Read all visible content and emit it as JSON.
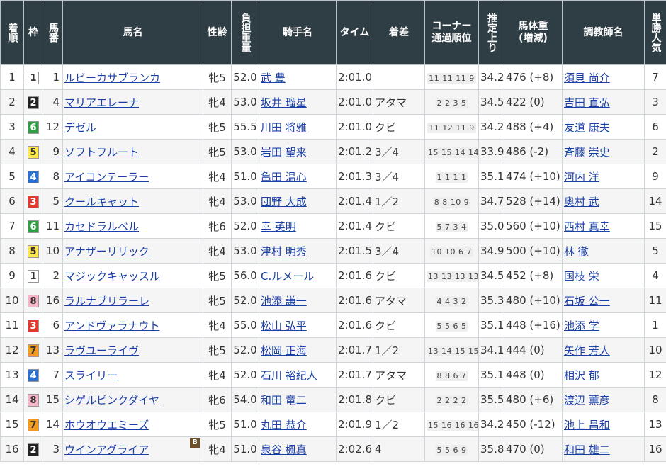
{
  "headers": {
    "finish": "着順",
    "waku": "枠",
    "number": "馬番",
    "horse": "馬名",
    "sexage": "性齢",
    "weight": "負担重量",
    "jockey": "騎手名",
    "time": "タイム",
    "margin": "着差",
    "corner": "コーナー通過順位",
    "last3f": "推定上り",
    "body_weight_line1": "馬体重",
    "body_weight_line2": "(増減)",
    "trainer": "調教師名",
    "popularity": "単勝人気"
  },
  "waku_colors": {
    "1": {
      "bg": "#ffffff",
      "fg": "#333333"
    },
    "2": {
      "bg": "#222222",
      "fg": "#ffffff"
    },
    "3": {
      "bg": "#e03a2f",
      "fg": "#ffffff"
    },
    "4": {
      "bg": "#2b6fd1",
      "fg": "#ffffff"
    },
    "5": {
      "bg": "#ffe84a",
      "fg": "#333333"
    },
    "6": {
      "bg": "#2f9e44",
      "fg": "#ffffff"
    },
    "7": {
      "bg": "#f39a22",
      "fg": "#333333"
    },
    "8": {
      "bg": "#f7b6c8",
      "fg": "#333333"
    }
  },
  "blinker_label": "B",
  "rows": [
    {
      "finish": "1",
      "waku": "1",
      "number": "1",
      "horse": "ルビーカサブランカ",
      "sexage": "牝5",
      "weight": "52.0",
      "jockey": "武 豊",
      "time": "2:01.0",
      "margin": "",
      "corner": "11 11 11 9",
      "last3f": "34.2",
      "body_weight": "476 (+8)",
      "trainer": "須貝 尚介",
      "popularity": "7",
      "blinker": false
    },
    {
      "finish": "2",
      "waku": "2",
      "number": "4",
      "horse": "マリアエレーナ",
      "sexage": "牝4",
      "weight": "53.0",
      "jockey": "坂井 瑠星",
      "time": "2:01.0",
      "margin": "アタマ",
      "corner": "2 2 3 5",
      "last3f": "34.5",
      "body_weight": "422 (0)",
      "trainer": "吉田 直弘",
      "popularity": "3",
      "blinker": false
    },
    {
      "finish": "3",
      "waku": "6",
      "number": "12",
      "horse": "デゼル",
      "sexage": "牝5",
      "weight": "55.5",
      "jockey": "川田 将雅",
      "time": "2:01.0",
      "margin": "クビ",
      "corner": "11 12 11 9",
      "last3f": "34.2",
      "body_weight": "488 (+4)",
      "trainer": "友道 康夫",
      "popularity": "6",
      "blinker": false
    },
    {
      "finish": "4",
      "waku": "5",
      "number": "9",
      "horse": "ソフトフルート",
      "sexage": "牝5",
      "weight": "53.0",
      "jockey": "岩田 望来",
      "time": "2:01.2",
      "margin": "3／4",
      "corner": "15 15 14 14",
      "last3f": "33.9",
      "body_weight": "486 (-2)",
      "trainer": "斉藤 崇史",
      "popularity": "2",
      "blinker": false
    },
    {
      "finish": "5",
      "waku": "4",
      "number": "8",
      "horse": "アイコンテーラー",
      "sexage": "牝4",
      "weight": "51.0",
      "jockey": "亀田 温心",
      "time": "2:01.3",
      "margin": "3／4",
      "corner": "1 1 1 1",
      "last3f": "35.1",
      "body_weight": "474 (+10)",
      "trainer": "河内 洋",
      "popularity": "9",
      "blinker": false
    },
    {
      "finish": "6",
      "waku": "3",
      "number": "5",
      "horse": "クールキャット",
      "sexage": "牝4",
      "weight": "53.0",
      "jockey": "団野 大成",
      "time": "2:01.4",
      "margin": "1／2",
      "corner": "8 8 10 9",
      "last3f": "34.7",
      "body_weight": "528 (+14)",
      "trainer": "奥村 武",
      "popularity": "14",
      "blinker": false
    },
    {
      "finish": "7",
      "waku": "6",
      "number": "11",
      "horse": "カセドラルベル",
      "sexage": "牝6",
      "weight": "52.0",
      "jockey": "幸 英明",
      "time": "2:01.4",
      "margin": "クビ",
      "corner": "5 7 3 4",
      "last3f": "35.0",
      "body_weight": "560 (+10)",
      "trainer": "西村 真幸",
      "popularity": "15",
      "blinker": false
    },
    {
      "finish": "8",
      "waku": "5",
      "number": "10",
      "horse": "アナザーリリック",
      "sexage": "牝4",
      "weight": "53.0",
      "jockey": "津村 明秀",
      "time": "2:01.5",
      "margin": "3／4",
      "corner": "10 10 6 7",
      "last3f": "34.9",
      "body_weight": "500 (+10)",
      "trainer": "林 徹",
      "popularity": "5",
      "blinker": false
    },
    {
      "finish": "9",
      "waku": "1",
      "number": "2",
      "horse": "マジックキャッスル",
      "sexage": "牝5",
      "weight": "56.0",
      "jockey": "C.ルメール",
      "time": "2:01.6",
      "margin": "クビ",
      "corner": "13 13 13 13",
      "last3f": "34.5",
      "body_weight": "452 (+8)",
      "trainer": "国枝 栄",
      "popularity": "4",
      "blinker": false
    },
    {
      "finish": "10",
      "waku": "8",
      "number": "16",
      "horse": "ラルナブリラーレ",
      "sexage": "牝5",
      "weight": "52.0",
      "jockey": "池添 謙一",
      "time": "2:01.6",
      "margin": "アタマ",
      "corner": "4 4 3 2",
      "last3f": "35.3",
      "body_weight": "480 (+10)",
      "trainer": "石坂 公一",
      "popularity": "11",
      "blinker": false
    },
    {
      "finish": "11",
      "waku": "3",
      "number": "6",
      "horse": "アンドヴァラナウト",
      "sexage": "牝4",
      "weight": "55.0",
      "jockey": "松山 弘平",
      "time": "2:01.6",
      "margin": "クビ",
      "corner": "5 5 6 5",
      "last3f": "35.1",
      "body_weight": "448 (+16)",
      "trainer": "池添 学",
      "popularity": "1",
      "blinker": false
    },
    {
      "finish": "12",
      "waku": "7",
      "number": "13",
      "horse": "ラヴユーライヴ",
      "sexage": "牝5",
      "weight": "52.0",
      "jockey": "松岡 正海",
      "time": "2:01.7",
      "margin": "1／2",
      "corner": "13 14 15 15",
      "last3f": "34.1",
      "body_weight": "444 (0)",
      "trainer": "矢作 芳人",
      "popularity": "10",
      "blinker": false
    },
    {
      "finish": "13",
      "waku": "4",
      "number": "7",
      "horse": "スライリー",
      "sexage": "牝4",
      "weight": "52.0",
      "jockey": "石川 裕紀人",
      "time": "2:01.7",
      "margin": "アタマ",
      "corner": "8 8 6 7",
      "last3f": "35.1",
      "body_weight": "448 (0)",
      "trainer": "相沢 郁",
      "popularity": "12",
      "blinker": false
    },
    {
      "finish": "14",
      "waku": "8",
      "number": "15",
      "horse": "シゲルピンクダイヤ",
      "sexage": "牝6",
      "weight": "54.0",
      "jockey": "和田 竜二",
      "time": "2:01.8",
      "margin": "クビ",
      "corner": "2 2 2 2",
      "last3f": "35.5",
      "body_weight": "480 (+6)",
      "trainer": "渡辺 薫彦",
      "popularity": "8",
      "blinker": false
    },
    {
      "finish": "15",
      "waku": "7",
      "number": "14",
      "horse": "ホウオウエミーズ",
      "sexage": "牝5",
      "weight": "51.0",
      "jockey": "丸田 恭介",
      "time": "2:01.9",
      "margin": "1／2",
      "corner": "15 16 16 16",
      "last3f": "34.2",
      "body_weight": "450 (-12)",
      "trainer": "池上 昌和",
      "popularity": "13",
      "blinker": false
    },
    {
      "finish": "16",
      "waku": "2",
      "number": "3",
      "horse": "ウインアグライア",
      "sexage": "牝4",
      "weight": "51.0",
      "jockey": "泉谷 楓真",
      "time": "2:02.6",
      "margin": "4",
      "corner": "5 5 6 9",
      "last3f": "35.8",
      "body_weight": "470 (0)",
      "trainer": "和田 雄二",
      "popularity": "16",
      "blinker": true
    }
  ]
}
